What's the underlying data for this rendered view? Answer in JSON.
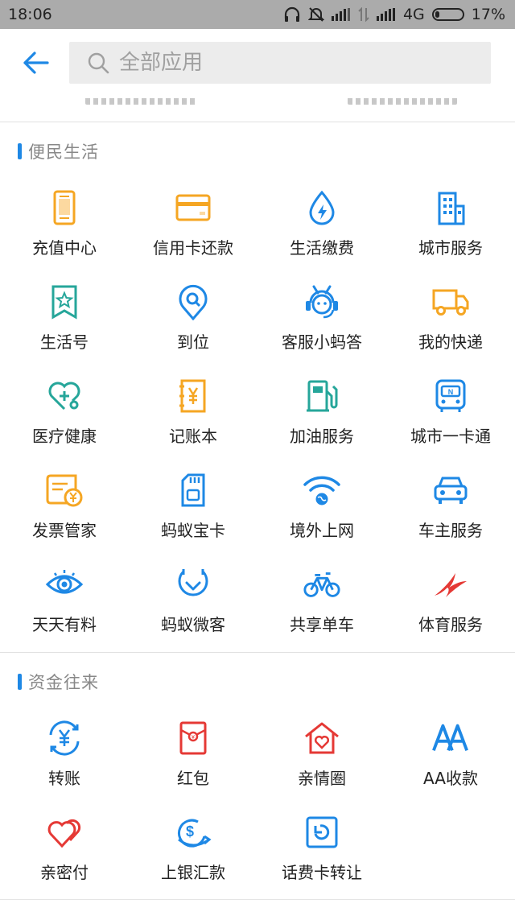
{
  "status_bar": {
    "time": "18:06",
    "network": "4G",
    "battery": "17%"
  },
  "header": {
    "search_placeholder": "全部应用"
  },
  "sections": [
    {
      "title": "便民生活",
      "items": [
        {
          "label": "充值中心",
          "icon": "phone-icon",
          "color": "#f5a623"
        },
        {
          "label": "信用卡还款",
          "icon": "credit-card-icon",
          "color": "#f5a623"
        },
        {
          "label": "生活缴费",
          "icon": "water-bolt-icon",
          "color": "#1e88e5"
        },
        {
          "label": "城市服务",
          "icon": "building-icon",
          "color": "#1e88e5"
        },
        {
          "label": "生活号",
          "icon": "bookmark-star-icon",
          "color": "#26a69a"
        },
        {
          "label": "到位",
          "icon": "location-search-icon",
          "color": "#1e88e5"
        },
        {
          "label": "客服小蚂答",
          "icon": "ant-headset-icon",
          "color": "#1e88e5"
        },
        {
          "label": "我的快递",
          "icon": "truck-icon",
          "color": "#f5a623"
        },
        {
          "label": "医疗健康",
          "icon": "stethoscope-icon",
          "color": "#26a69a"
        },
        {
          "label": "记账本",
          "icon": "ledger-yen-icon",
          "color": "#f5a623"
        },
        {
          "label": "加油服务",
          "icon": "fuel-pump-icon",
          "color": "#26a69a"
        },
        {
          "label": "城市一卡通",
          "icon": "bus-icon",
          "color": "#1e88e5"
        },
        {
          "label": "发票管家",
          "icon": "invoice-icon",
          "color": "#f5a623"
        },
        {
          "label": "蚂蚁宝卡",
          "icon": "sim-card-icon",
          "color": "#1e88e5"
        },
        {
          "label": "境外上网",
          "icon": "wifi-globe-icon",
          "color": "#1e88e5"
        },
        {
          "label": "车主服务",
          "icon": "car-icon",
          "color": "#1e88e5"
        },
        {
          "label": "天天有料",
          "icon": "eye-icon",
          "color": "#1e88e5"
        },
        {
          "label": "蚂蚁微客",
          "icon": "shield-check-icon",
          "color": "#1e88e5"
        },
        {
          "label": "共享单车",
          "icon": "bicycle-icon",
          "color": "#1e88e5"
        },
        {
          "label": "体育服务",
          "icon": "sports-swoosh-icon",
          "color": "#e53935"
        }
      ]
    },
    {
      "title": "资金往来",
      "items": [
        {
          "label": "转账",
          "icon": "transfer-yen-icon",
          "color": "#1e88e5"
        },
        {
          "label": "红包",
          "icon": "red-envelope-icon",
          "color": "#e53935"
        },
        {
          "label": "亲情圈",
          "icon": "home-heart-icon",
          "color": "#e53935"
        },
        {
          "label": "AA收款",
          "icon": "aa-icon",
          "color": "#1e88e5"
        },
        {
          "label": "亲密付",
          "icon": "double-heart-icon",
          "color": "#e53935"
        },
        {
          "label": "上银汇款",
          "icon": "dollar-swoosh-icon",
          "color": "#1e88e5"
        },
        {
          "label": "话费卡转让",
          "icon": "card-refresh-icon",
          "color": "#1e88e5"
        }
      ]
    }
  ]
}
